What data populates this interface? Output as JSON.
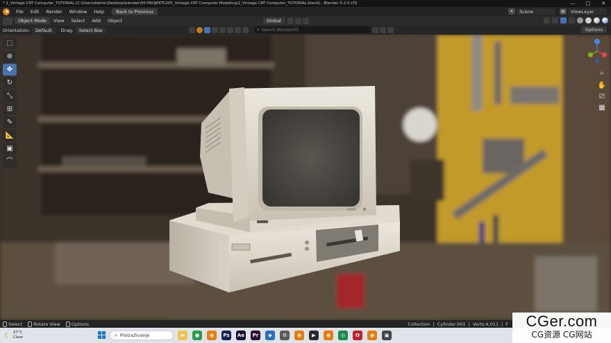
{
  "window": {
    "title": "* 2_Vintage CRT Computer_TUTORIAL [C:\\Users\\Admin\\Desktop\\blender\\00-PROJEKTI\\205_Vintage CRT Computer Modeling\\2_Vintage CRT Computer_TUTORIAL.blend] - Blender 5.2.0 LTS",
    "controls": [
      "—",
      "□",
      "✕"
    ]
  },
  "menubar": {
    "items": [
      "File",
      "Edit",
      "Render",
      "Window",
      "Help"
    ],
    "back_button": "Back to Previous",
    "scene": "Scene",
    "view_layer": "ViewLayer"
  },
  "header": {
    "mode": "Object Mode",
    "menus": [
      "View",
      "Select",
      "Add",
      "Object"
    ],
    "transform_orientation": "Global"
  },
  "tool_settings": {
    "orientation_label": "Orientation:",
    "orientation_value": "Default",
    "drag_label": "Drag:",
    "drag_value": "Select Box",
    "search_placeholder": "Search BlenderKit",
    "options_label": "Options"
  },
  "toolbar": {
    "tools": [
      {
        "name": "select-box-tool",
        "glyph": "⬚",
        "active": false
      },
      {
        "name": "cursor-tool",
        "glyph": "⊕",
        "active": false
      },
      {
        "name": "move-tool",
        "glyph": "✥",
        "active": true
      },
      {
        "name": "rotate-tool",
        "glyph": "↻",
        "active": false
      },
      {
        "name": "scale-tool",
        "glyph": "⤡",
        "active": false
      },
      {
        "name": "transform-tool",
        "glyph": "⊞",
        "active": false
      },
      {
        "name": "annotate-tool",
        "glyph": "✎",
        "active": false
      },
      {
        "name": "measure-tool",
        "glyph": "📐",
        "active": false
      },
      {
        "name": "add-cube-tool",
        "glyph": "▣",
        "active": false
      },
      {
        "name": "curve-tool",
        "glyph": "⌒",
        "active": false
      }
    ]
  },
  "statusbar": {
    "select": "Select",
    "rotate_view": "Rotate View",
    "options": "Options",
    "collection": "Collection",
    "object": "Cylinder.001",
    "verts": "Verts:4,011",
    "extra": "F"
  },
  "taskbar": {
    "temperature": "27°C",
    "weather": "Clear",
    "search_text": "Pretraživanje"
  },
  "watermark": {
    "line1": "CGer.com",
    "line2": "CG资源 CG网站"
  },
  "colors": {
    "accent": "#4772b3",
    "blender_orange": "#e87d0d",
    "axis_x": "#e8434f",
    "axis_y": "#7cb820",
    "axis_z": "#3d8de8"
  }
}
